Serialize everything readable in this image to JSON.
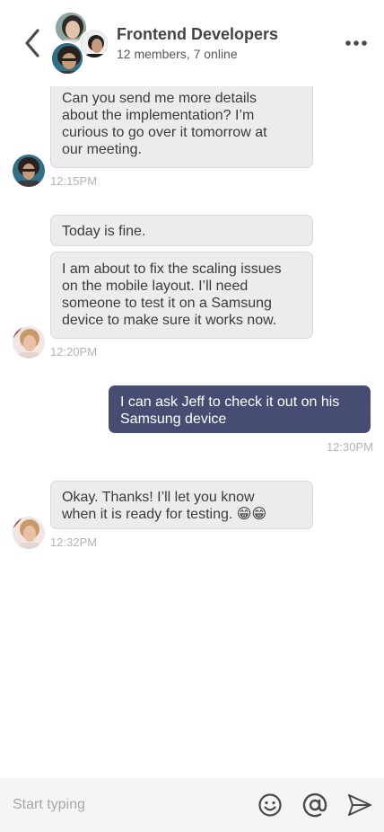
{
  "header": {
    "back_icon": "chevron-left-icon",
    "title": "Frontend Developers",
    "subtitle": "12 members, 7 online",
    "more_icon": "more-horizontal-icon"
  },
  "messages": [
    {
      "direction": "in",
      "text": "Can you send me more details\nabout the implementation? I’m\ncurious to go over it tomorrow at\nour meeting.",
      "time": "12:15PM"
    },
    {
      "direction": "in",
      "text": "Today is fine.",
      "time": ""
    },
    {
      "direction": "in",
      "text": "I am about to fix the scaling issues\non the mobile layout. I’ll need\nsomeone to test it on a Samsung\ndevice to make sure it works now.",
      "time": "12:20PM"
    },
    {
      "direction": "out",
      "text": "I can ask Jeff to check it out on his\nSamsung device",
      "time": "12:30PM"
    },
    {
      "direction": "in",
      "text": "Okay. Thanks! I’ll let you know\nwhen it is ready for testing. 😁😁",
      "time": "12:32PM"
    }
  ],
  "composer": {
    "placeholder": "Start typing",
    "emoji_icon": "smiley-icon",
    "mention_icon": "at-sign-icon",
    "send_icon": "send-icon"
  },
  "colors": {
    "incoming_bubble": "#ececec",
    "outgoing_bubble": "#474d72",
    "timestamp": "#b3b3b3",
    "composer_bg": "#f5f5f5"
  }
}
